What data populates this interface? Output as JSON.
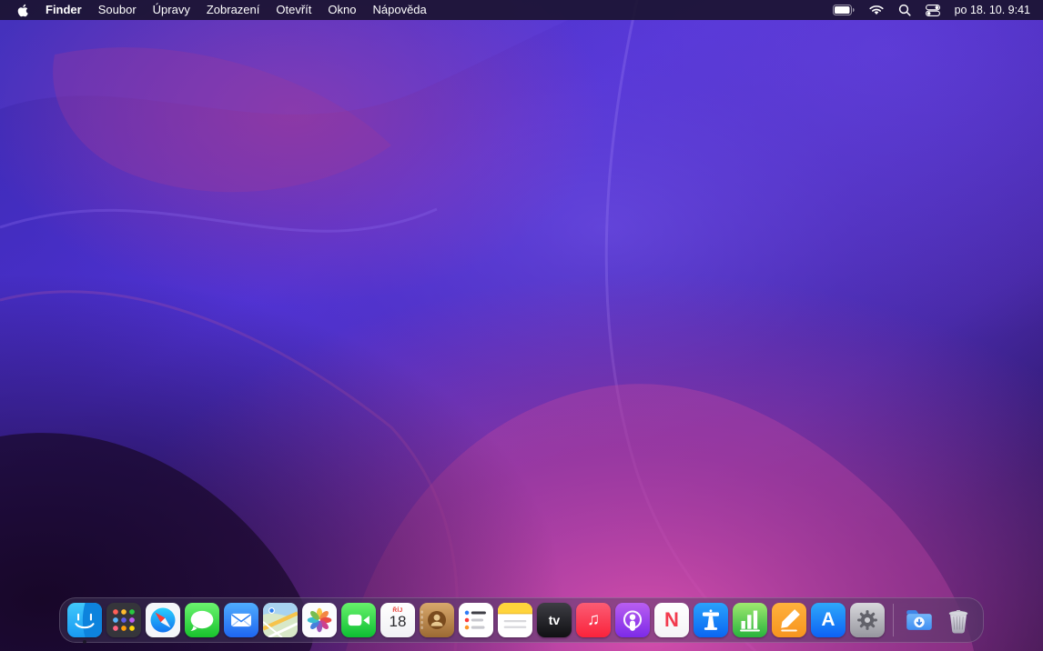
{
  "menu_bar": {
    "menus": [
      {
        "label": "Finder"
      },
      {
        "label": "Soubor"
      },
      {
        "label": "Úpravy"
      },
      {
        "label": "Zobrazení"
      },
      {
        "label": "Otevřít"
      },
      {
        "label": "Okno"
      },
      {
        "label": "Nápověda"
      }
    ],
    "status": {
      "clock": "po 18. 10. 9:41",
      "icons": [
        "battery-icon",
        "wifi-icon",
        "spotlight-search-icon",
        "control-center-icon"
      ]
    }
  },
  "wallpaper": {
    "style": "macOS Monterey abstract waves, dark variant",
    "colors": {
      "base_purple": "#4b2fc4",
      "deep_purple": "#1c0e3c",
      "magenta_glow": "#c24aa4",
      "dark_corner": "#190a2e"
    }
  },
  "dock": {
    "icons": [
      "finder-icon",
      "launchpad-icon",
      "safari-icon",
      "messages-icon",
      "mail-icon",
      "maps-icon",
      "photos-icon",
      "facetime-icon",
      "calendar-icon",
      "contacts-icon",
      "reminders-icon",
      "notes-icon",
      "tv-icon",
      "music-icon",
      "podcasts-icon",
      "news-icon",
      "keynote-icon",
      "numbers-icon",
      "pages-icon",
      "app-store-icon",
      "system-preferences-icon",
      "downloads-folder-icon",
      "trash-icon"
    ],
    "running_apps": [
      "finder"
    ],
    "calendar": {
      "month": "ŘÍJ",
      "day": "18"
    },
    "tv_label": "tv",
    "music_glyph": "♫",
    "news_letter": "N",
    "appstore_letter": "A"
  }
}
